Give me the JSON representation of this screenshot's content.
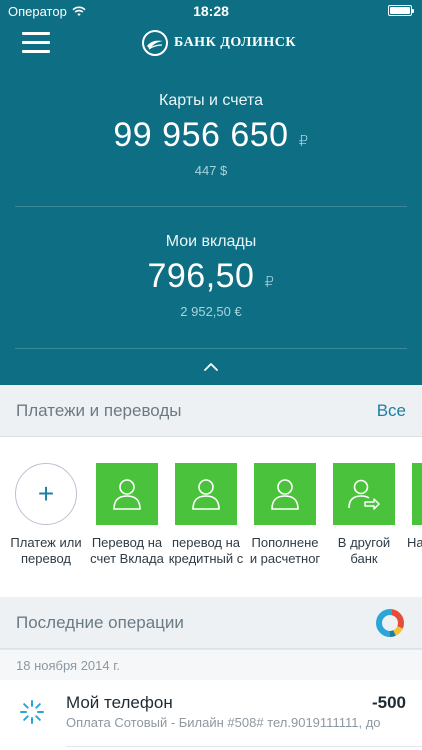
{
  "status_bar": {
    "carrier": "Оператор",
    "time": "18:28",
    "wifi_icon": "wifi-icon",
    "battery_icon": "battery-icon"
  },
  "header": {
    "logo_text": "БАНК ДОЛИНСК",
    "menu_icon": "hamburger-menu-icon"
  },
  "cards_accounts": {
    "title": "Карты и счета",
    "amount": "99 956 650",
    "currency": "₽",
    "sub_amount": "447 $"
  },
  "deposits": {
    "title": "Мои вклады",
    "amount": "796,50",
    "currency": "₽",
    "sub_amount": "2 952,50 €"
  },
  "payments": {
    "title": "Платежи и переводы",
    "all_label": "Все",
    "tiles": [
      {
        "icon": "plus-icon",
        "label_line1": "Платеж или",
        "label_line2": "перевод"
      },
      {
        "icon": "user-icon",
        "label_line1": "Перевод на",
        "label_line2": "счет Вклада"
      },
      {
        "icon": "user-icon",
        "label_line1": "перевод на",
        "label_line2": "кредитный с"
      },
      {
        "icon": "user-icon",
        "label_line1": "Пополнене",
        "label_line2": "и расчетног"
      },
      {
        "icon": "transfer-user-icon",
        "label_line1": "В другой",
        "label_line2": "банк"
      },
      {
        "icon": "user-icon",
        "label_line1": "На",
        "label_line2": ""
      }
    ]
  },
  "recent": {
    "title": "Последние операции",
    "chart_icon": "donut-chart-icon",
    "date": "18 ноября 2014 г.",
    "operation": {
      "icon": "loading-spinner-icon",
      "title": "Мой телефон",
      "amount": "-500",
      "description": "Оплата Сотовый - Билайн #508# тел.9019111111, до"
    }
  },
  "colors": {
    "teal": "#0e6f84",
    "green": "#4bc23c",
    "link_blue": "#1f7fa2"
  }
}
